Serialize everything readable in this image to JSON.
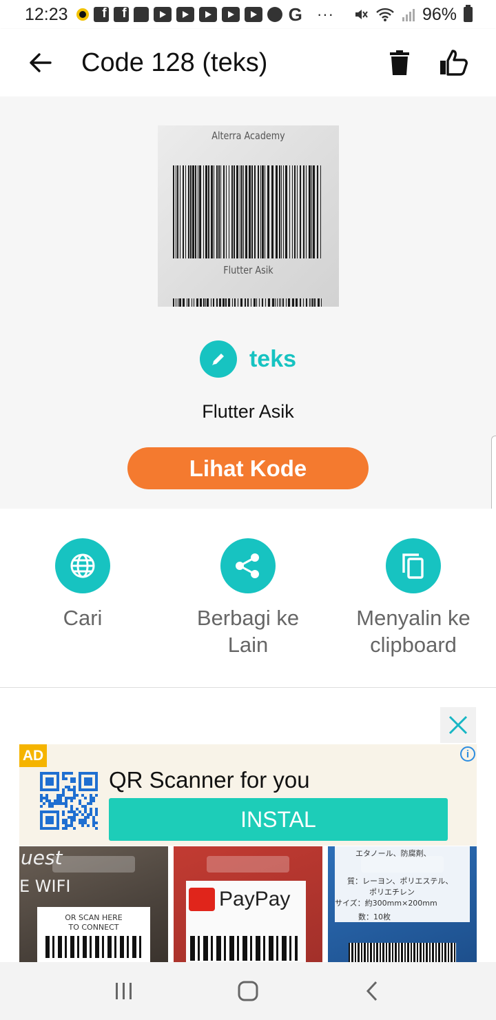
{
  "status_bar": {
    "time": "12:23",
    "battery": "96%",
    "dots": "···",
    "g_label": "G",
    "notification_icons": [
      "circle-icon",
      "facebook-icon",
      "facebook-icon",
      "chat-icon",
      "youtube-icon",
      "youtube-icon",
      "youtube-icon",
      "youtube-icon",
      "youtube-icon",
      "circle-icon",
      "google-icon"
    ]
  },
  "app_bar": {
    "title": "Code 128 (teks)",
    "back_icon": "arrow-left-icon",
    "delete_icon": "trash-icon",
    "like_icon": "thumbs-up-icon"
  },
  "scan": {
    "image_top_text": "Alterra Academy",
    "image_bottom_text": "Flutter Asik",
    "type_label": "teks",
    "content": "Flutter Asik",
    "view_code_button": "Lihat Kode"
  },
  "actions": [
    {
      "label": "Cari",
      "icon": "globe-icon"
    },
    {
      "label": "Berbagi ke Lain",
      "icon": "share-icon"
    },
    {
      "label": "Menyalin ke clipboard",
      "icon": "copy-icon"
    }
  ],
  "ad": {
    "badge": "AD",
    "info": "i",
    "title": "QR Scanner for you",
    "install_button": "INSTAL",
    "shots": [
      {
        "line1": "uest",
        "line2": "E WIFI",
        "card_line1": "OR SCAN HERE",
        "card_line2": "TO CONNECT"
      },
      {
        "brand": "PayPay"
      },
      {
        "jp_line1": "エタノール、防腐剤、",
        "jp_line2": "質：レーヨン、ポリエステル、",
        "jp_line3": "ポリエチレン",
        "jp_line4": "サイズ：約300mm×200mm",
        "jp_line5": "数：10枚"
      }
    ]
  },
  "colors": {
    "accent_teal": "#17c3c1",
    "button_orange": "#f47a2f",
    "install_green": "#1dcdb8",
    "ad_badge": "#f5b400"
  }
}
